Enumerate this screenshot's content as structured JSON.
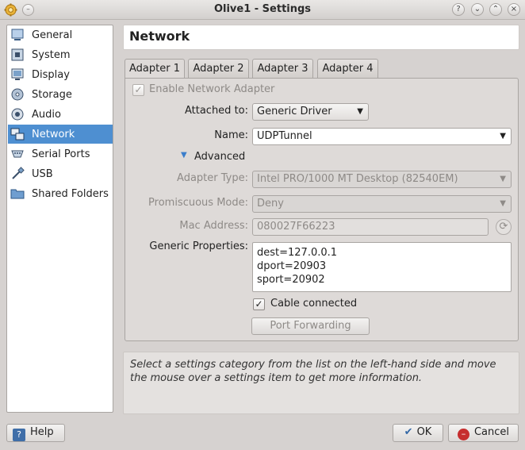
{
  "window": {
    "title": "Olive1 - Settings",
    "controls": [
      "help-icon",
      "minimize-icon",
      "maximize-icon",
      "close-icon"
    ]
  },
  "sidebar": {
    "items": [
      {
        "label": "General",
        "icon": "general-icon",
        "selected": false
      },
      {
        "label": "System",
        "icon": "system-icon",
        "selected": false
      },
      {
        "label": "Display",
        "icon": "display-icon",
        "selected": false
      },
      {
        "label": "Storage",
        "icon": "storage-icon",
        "selected": false
      },
      {
        "label": "Audio",
        "icon": "audio-icon",
        "selected": false
      },
      {
        "label": "Network",
        "icon": "network-icon",
        "selected": true
      },
      {
        "label": "Serial Ports",
        "icon": "serial-ports-icon",
        "selected": false
      },
      {
        "label": "USB",
        "icon": "usb-icon",
        "selected": false
      },
      {
        "label": "Shared Folders",
        "icon": "shared-folders-icon",
        "selected": false
      }
    ]
  },
  "page": {
    "title": "Network"
  },
  "tabs": [
    {
      "label": "Adapter 1",
      "active": true
    },
    {
      "label": "Adapter 2",
      "active": false
    },
    {
      "label": "Adapter 3",
      "active": false
    },
    {
      "label": "Adapter 4",
      "active": false
    }
  ],
  "adapter": {
    "enable_label": "Enable Network Adapter",
    "enable_checked": true,
    "attached_label": "Attached to:",
    "attached_value": "Generic Driver",
    "name_label": "Name:",
    "name_value": "UDPTunnel",
    "advanced_label": "Advanced",
    "adapter_type_label": "Adapter Type:",
    "adapter_type_value": "Intel PRO/1000 MT Desktop (82540EM)",
    "promiscuous_label": "Promiscuous Mode:",
    "promiscuous_value": "Deny",
    "mac_label": "Mac Address:",
    "mac_value": "080027F66223",
    "generic_props_label": "Generic Properties:",
    "generic_props_lines": [
      "dest=127.0.0.1",
      "dport=20903",
      "sport=20902"
    ],
    "cable_label": "Cable connected",
    "cable_checked": true,
    "port_forwarding_label": "Port Forwarding"
  },
  "info_text": "Select a settings category from the list on the left-hand side and move the mouse over a settings item to get more information.",
  "footer": {
    "help_label": "Help",
    "ok_label": "OK",
    "cancel_label": "Cancel"
  }
}
